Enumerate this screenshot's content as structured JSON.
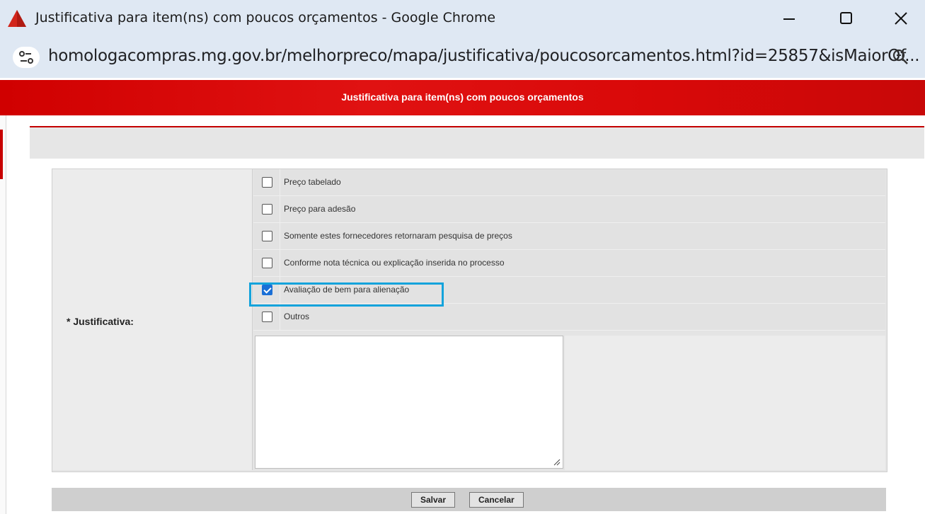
{
  "window": {
    "title": "Justificativa para item(ns) com poucos orçamentos - Google Chrome",
    "url": "homologacompras.mg.gov.br/melhorpreco/mapa/justificativa/poucosorcamentos.html?id=25857&isMaiorOf..."
  },
  "page": {
    "header_title": "Justificativa para item(ns) com poucos orçamentos"
  },
  "form": {
    "field_label": "* Justificativa:",
    "options": [
      {
        "label": "Preço tabelado",
        "checked": false
      },
      {
        "label": "Preço para adesão",
        "checked": false
      },
      {
        "label": "Somente estes fornecedores retornaram pesquisa de preços",
        "checked": false
      },
      {
        "label": "Conforme nota técnica ou explicação inserida no processo",
        "checked": false
      },
      {
        "label": "Avaliação de bem para alienação",
        "checked": true
      },
      {
        "label": "Outros",
        "checked": false
      }
    ],
    "textarea_value": ""
  },
  "buttons": {
    "save": "Salvar",
    "cancel": "Cancelar"
  },
  "colors": {
    "header_red": "#d00000",
    "highlight": "#14a3dc",
    "checkbox_blue": "#1a6fd6"
  }
}
